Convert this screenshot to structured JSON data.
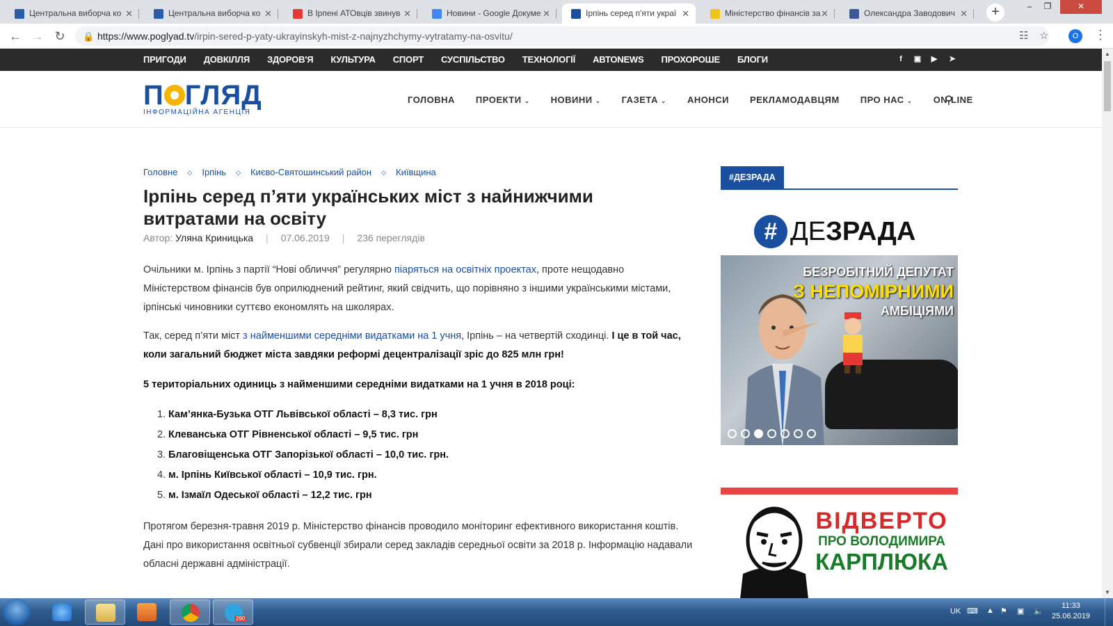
{
  "browser": {
    "tabs": [
      {
        "title": "Центральна виборча ко",
        "fav_color": "#2b5ca8",
        "active": false
      },
      {
        "title": "Центральна виборча ко",
        "fav_color": "#2b5ca8",
        "active": false
      },
      {
        "title": "В Ірпені АТОвців звинув",
        "fav_color": "#e53935",
        "active": false
      },
      {
        "title": "Новини - Google Докуме",
        "fav_color": "#4285f4",
        "active": false
      },
      {
        "title": "Ірпінь серед п'яти украї",
        "fav_color": "#1a4fa0",
        "active": true
      },
      {
        "title": "Міністерство фінансів за",
        "fav_color": "#f0c419",
        "active": false
      },
      {
        "title": "Олександра Заводович",
        "fav_color": "#3b5998",
        "active": false
      }
    ],
    "url_host": "https://www.poglyad.tv",
    "url_path": "/irpin-sered-p-yaty-ukrayinskyh-mist-z-najnyzhchymy-vytratamy-na-osvitu/",
    "profile_initial": "O"
  },
  "site": {
    "top_categories": [
      "ПРИГОДИ",
      "ДОВКІЛЛЯ",
      "ЗДОРОВ'Я",
      "КУЛЬТУРА",
      "СПОРТ",
      "СУСПІЛЬСТВО",
      "ТЕХНОЛОГІЇ",
      "АВТОNEWS",
      "ПРОХОРОШЕ",
      "БЛОГИ"
    ],
    "logo_text": "ПОГЛЯД",
    "logo_sub": "ІНФОРМАЦІЙНА АГЕНЦІЯ",
    "main_nav": [
      {
        "label": "ГОЛОВНА",
        "dropdown": false
      },
      {
        "label": "ПРОЕКТИ",
        "dropdown": true
      },
      {
        "label": "НОВИНИ",
        "dropdown": true
      },
      {
        "label": "ГАЗЕТА",
        "dropdown": true
      },
      {
        "label": "АНОНСИ",
        "dropdown": false
      },
      {
        "label": "РЕКЛАМОДАВЦЯМ",
        "dropdown": false
      },
      {
        "label": "ПРО НАС",
        "dropdown": true
      },
      {
        "label": "ON-LINE",
        "dropdown": false
      }
    ]
  },
  "article": {
    "breadcrumbs": [
      "Головне",
      "Ірпінь",
      "Києво-Святошинський район",
      "Київщина"
    ],
    "title": "Ірпінь серед п’яти українських міст з найнижчими витратами на освіту",
    "author_label": "Автор:",
    "author": "Уляна Криницька",
    "date": "07.06.2019",
    "views": "236 переглядів",
    "p1_a": "Очільники м. Ірпінь з партії “Нові обличчя” регулярно ",
    "p1_link": "піаряться на освітніх проектах",
    "p1_b": ", проте нещодавно Міністерством фінансів був оприлюднений рейтинг, який свідчить, що порівняно з іншими українськими містами, ірпінські чиновники суттєво економлять на школярах.",
    "p2_a": "Так, серед п’яти міст ",
    "p2_link": "з найменшими середніми видатками на 1 учня",
    "p2_b": ", Ірпінь – на четвертій сходинці. ",
    "p2_bold": "І це в той час, коли загальний бюджет міста завдяки реформі децентралізації зріс до 825 млн грн!",
    "p3_bold": "5 територіальних одиниць з найменшими середніми видатками на 1 учня в 2018 році:",
    "list": [
      "Кам’янка-Бузька ОТГ Львівської області – 8,3 тис. грн",
      "Клеванська ОТГ Рівненської області – 9,5 тис. грн",
      "Благовіщенська ОТГ Запорізької області – 10,0 тис. грн.",
      "м. Ірпінь Київської області – 10,9 тис. грн.",
      "м. Ізмаїл Одеської області – 12,2 тис. грн"
    ],
    "p4": "Протягом березня-травня 2019 р. Міністерство фінансів проводило моніторинг ефективного використання коштів. Дані про використання освітньої субвенції збирали серед закладів середньої освіти за 2018 р. Інформацію надавали обласні державні адміністрації."
  },
  "sidebar": {
    "tag": "#ДЕЗРАДА",
    "banner1": {
      "logo_hash": "#",
      "logo_a": "ДЕ",
      "logo_b": "ЗРАДА",
      "line1": "БЕЗРОБІТНИЙ ДЕПУТАТ",
      "line2": "З НЕПОМІРНИМИ",
      "line3": "АМБІЦІЯМИ",
      "active_slide": 3,
      "slide_count": 7
    },
    "banner2": {
      "line1": "ВІДВЕРТО",
      "line2": "ПРО ВОЛОДИМИРА",
      "line3": "КАРПЛЮКА"
    }
  },
  "taskbar": {
    "lang": "UK",
    "time": "11:33",
    "date": "25.06.2019",
    "telegram_badge": "290"
  }
}
